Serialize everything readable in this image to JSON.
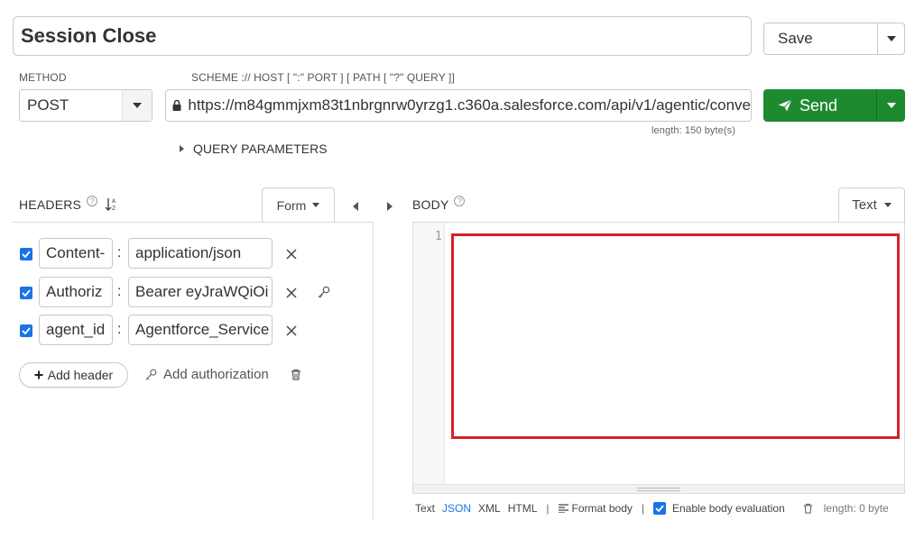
{
  "request": {
    "title": "Session Close",
    "save_label": "Save",
    "method_label": "METHOD",
    "method_value": "POST",
    "url_label": "SCHEME :// HOST [ \":\" PORT ] [ PATH [ \"?\" QUERY ]]",
    "url_value": "https://m84gmmjxm83t1nbrgnrw0yrzg1.c360a.salesforce.com/api/v1/agentic/conve",
    "url_length": "length: 150 byte(s)",
    "send_label": "Send",
    "query_params_label": "QUERY PARAMETERS"
  },
  "headers": {
    "title": "HEADERS",
    "help": "?",
    "sort_icon_text": "↓",
    "form_label": "Form",
    "rows": [
      {
        "name": "Content-",
        "value": "application/json",
        "checked": true
      },
      {
        "name": "Authoriz",
        "value": "Bearer eyJraWQiOi",
        "checked": true
      },
      {
        "name": "agent_id",
        "value": "Agentforce_Service",
        "checked": true
      }
    ],
    "add_header_label": "Add header",
    "add_auth_label": "Add authorization"
  },
  "body": {
    "title": "BODY",
    "help": "?",
    "format_label": "Text",
    "line_number": "1",
    "footer": {
      "text_label": "Text",
      "json_label": "JSON",
      "xml_label": "XML",
      "html_label": "HTML",
      "sep": "|",
      "format_body_label": "Format body",
      "enable_eval_label": "Enable body evaluation",
      "length_label": "length: 0 byte"
    }
  },
  "colors": {
    "send_green": "#1e8a2f",
    "accent_blue": "#1a73e8",
    "highlight_red": "#d8202a"
  }
}
